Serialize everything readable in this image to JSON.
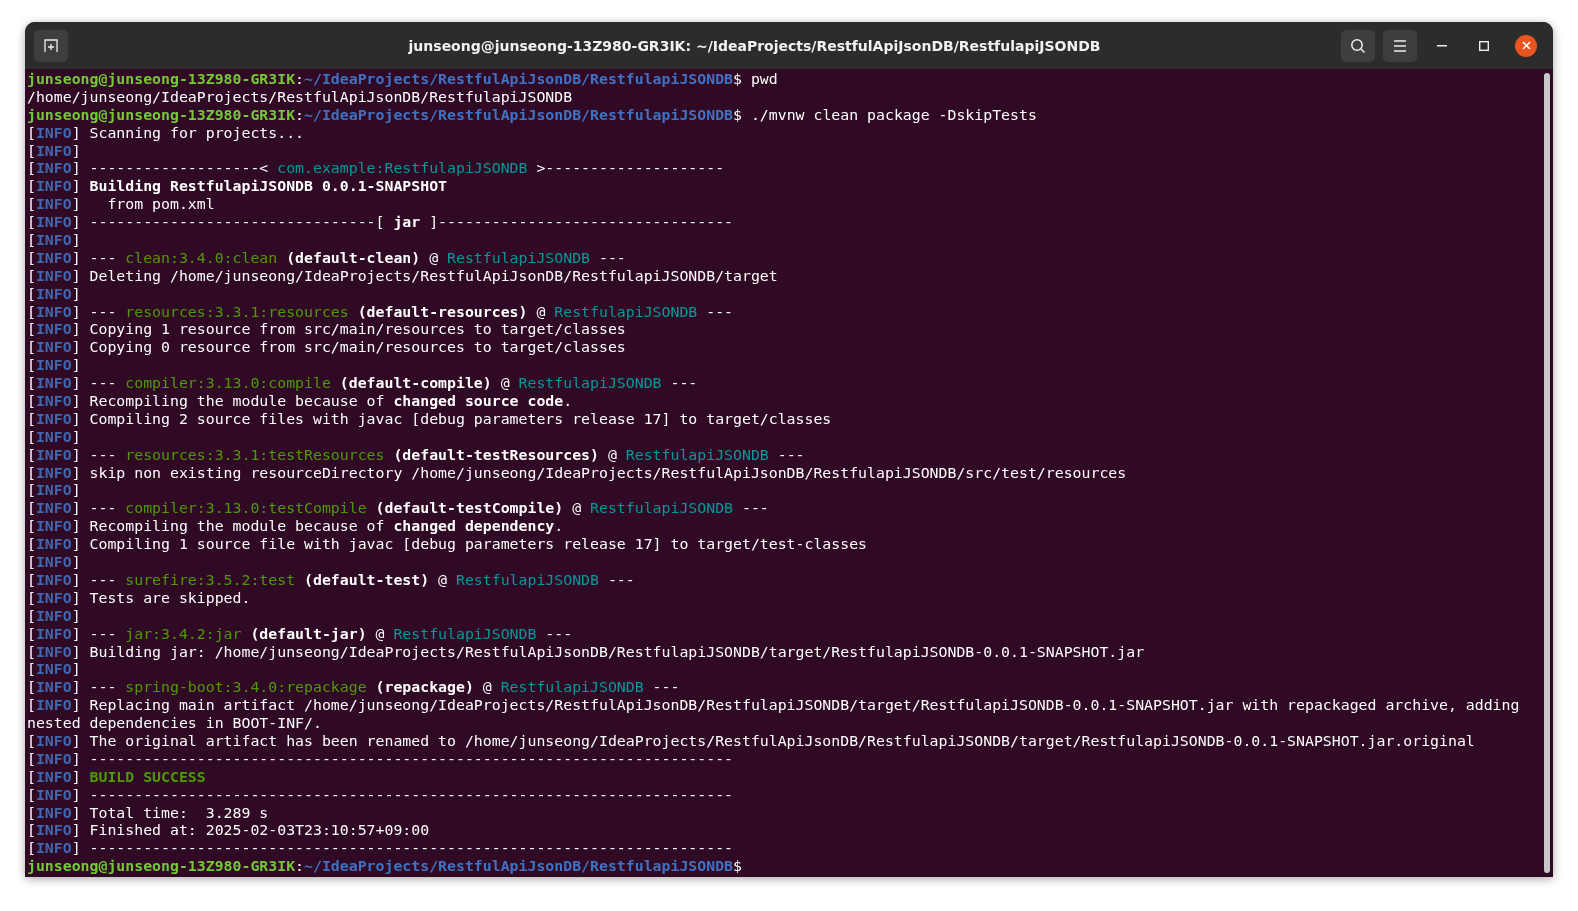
{
  "window": {
    "title": "junseong@junseong-13Z980-GR3IK: ~/IdeaProjects/RestfulApiJsonDB/RestfulapiJSONDB"
  },
  "terminal": {
    "lines": [
      {
        "segments": [
          {
            "kind": "user",
            "text": "junseong@junseong-13Z980-GR3IK"
          },
          {
            "kind": "text",
            "text": ":"
          },
          {
            "kind": "path",
            "text": "~/IdeaProjects/RestfulApiJsonDB/RestfulapiJSONDB"
          },
          {
            "kind": "text",
            "text": "$ pwd"
          }
        ]
      },
      {
        "segments": [
          {
            "kind": "text",
            "text": "/home/junseong/IdeaProjects/RestfulApiJsonDB/RestfulapiJSONDB"
          }
        ]
      },
      {
        "segments": [
          {
            "kind": "user",
            "text": "junseong@junseong-13Z980-GR3IK"
          },
          {
            "kind": "text",
            "text": ":"
          },
          {
            "kind": "path",
            "text": "~/IdeaProjects/RestfulApiJsonDB/RestfulapiJSONDB"
          },
          {
            "kind": "text",
            "text": "$ ./mvnw clean package -DskipTests"
          }
        ]
      },
      {
        "tag": "[INFO]",
        "segments": [
          {
            "kind": "text",
            "text": " Scanning for projects..."
          }
        ]
      },
      {
        "tag": "[INFO]"
      },
      {
        "tag": "[INFO]",
        "segments": [
          {
            "kind": "text",
            "text": " -------------------< "
          },
          {
            "kind": "artifact",
            "text": "com.example:RestfulapiJSONDB"
          },
          {
            "kind": "text",
            "text": " >--------------------"
          }
        ]
      },
      {
        "tag": "[INFO]",
        "segments": [
          {
            "kind": "bold",
            "text": " Building RestfulapiJSONDB 0.0.1-SNAPSHOT"
          }
        ]
      },
      {
        "tag": "[INFO]",
        "segments": [
          {
            "kind": "text",
            "text": "   from pom.xml"
          }
        ]
      },
      {
        "tag": "[INFO]",
        "segments": [
          {
            "kind": "text",
            "text": " --------------------------------[ "
          },
          {
            "kind": "bold",
            "text": "jar"
          },
          {
            "kind": "text",
            "text": " ]---------------------------------"
          }
        ]
      },
      {
        "tag": "[INFO]"
      },
      {
        "tag": "[INFO]",
        "segments": [
          {
            "kind": "text",
            "text": " --- "
          },
          {
            "kind": "plugin",
            "text": "clean:3.4.0:clean"
          },
          {
            "kind": "bold",
            "text": " (default-clean)"
          },
          {
            "kind": "text",
            "text": " @ "
          },
          {
            "kind": "artifact",
            "text": "RestfulapiJSONDB"
          },
          {
            "kind": "text",
            "text": " ---"
          }
        ]
      },
      {
        "tag": "[INFO]",
        "segments": [
          {
            "kind": "text",
            "text": " Deleting /home/junseong/IdeaProjects/RestfulApiJsonDB/RestfulapiJSONDB/target"
          }
        ]
      },
      {
        "tag": "[INFO]"
      },
      {
        "tag": "[INFO]",
        "segments": [
          {
            "kind": "text",
            "text": " --- "
          },
          {
            "kind": "plugin",
            "text": "resources:3.3.1:resources"
          },
          {
            "kind": "bold",
            "text": " (default-resources)"
          },
          {
            "kind": "text",
            "text": " @ "
          },
          {
            "kind": "artifact",
            "text": "RestfulapiJSONDB"
          },
          {
            "kind": "text",
            "text": " ---"
          }
        ]
      },
      {
        "tag": "[INFO]",
        "segments": [
          {
            "kind": "text",
            "text": " Copying 1 resource from src/main/resources to target/classes"
          }
        ]
      },
      {
        "tag": "[INFO]",
        "segments": [
          {
            "kind": "text",
            "text": " Copying 0 resource from src/main/resources to target/classes"
          }
        ]
      },
      {
        "tag": "[INFO]"
      },
      {
        "tag": "[INFO]",
        "segments": [
          {
            "kind": "text",
            "text": " --- "
          },
          {
            "kind": "plugin",
            "text": "compiler:3.13.0:compile"
          },
          {
            "kind": "bold",
            "text": " (default-compile)"
          },
          {
            "kind": "text",
            "text": " @ "
          },
          {
            "kind": "artifact",
            "text": "RestfulapiJSONDB"
          },
          {
            "kind": "text",
            "text": " ---"
          }
        ]
      },
      {
        "tag": "[INFO]",
        "segments": [
          {
            "kind": "text",
            "text": " Recompiling the module because of "
          },
          {
            "kind": "bold",
            "text": "changed source code"
          },
          {
            "kind": "text",
            "text": "."
          }
        ]
      },
      {
        "tag": "[INFO]",
        "segments": [
          {
            "kind": "text",
            "text": " Compiling 2 source files with javac [debug parameters release 17] to target/classes"
          }
        ]
      },
      {
        "tag": "[INFO]"
      },
      {
        "tag": "[INFO]",
        "segments": [
          {
            "kind": "text",
            "text": " --- "
          },
          {
            "kind": "plugin",
            "text": "resources:3.3.1:testResources"
          },
          {
            "kind": "bold",
            "text": " (default-testResources)"
          },
          {
            "kind": "text",
            "text": " @ "
          },
          {
            "kind": "artifact",
            "text": "RestfulapiJSONDB"
          },
          {
            "kind": "text",
            "text": " ---"
          }
        ]
      },
      {
        "tag": "[INFO]",
        "segments": [
          {
            "kind": "text",
            "text": " skip non existing resourceDirectory /home/junseong/IdeaProjects/RestfulApiJsonDB/RestfulapiJSONDB/src/test/resources"
          }
        ]
      },
      {
        "tag": "[INFO]"
      },
      {
        "tag": "[INFO]",
        "segments": [
          {
            "kind": "text",
            "text": " --- "
          },
          {
            "kind": "plugin",
            "text": "compiler:3.13.0:testCompile"
          },
          {
            "kind": "bold",
            "text": " (default-testCompile)"
          },
          {
            "kind": "text",
            "text": " @ "
          },
          {
            "kind": "artifact",
            "text": "RestfulapiJSONDB"
          },
          {
            "kind": "text",
            "text": " ---"
          }
        ]
      },
      {
        "tag": "[INFO]",
        "segments": [
          {
            "kind": "text",
            "text": " Recompiling the module because of "
          },
          {
            "kind": "bold",
            "text": "changed dependency"
          },
          {
            "kind": "text",
            "text": "."
          }
        ]
      },
      {
        "tag": "[INFO]",
        "segments": [
          {
            "kind": "text",
            "text": " Compiling 1 source file with javac [debug parameters release 17] to target/test-classes"
          }
        ]
      },
      {
        "tag": "[INFO]"
      },
      {
        "tag": "[INFO]",
        "segments": [
          {
            "kind": "text",
            "text": " --- "
          },
          {
            "kind": "plugin",
            "text": "surefire:3.5.2:test"
          },
          {
            "kind": "bold",
            "text": " (default-test)"
          },
          {
            "kind": "text",
            "text": " @ "
          },
          {
            "kind": "artifact",
            "text": "RestfulapiJSONDB"
          },
          {
            "kind": "text",
            "text": " ---"
          }
        ]
      },
      {
        "tag": "[INFO]",
        "segments": [
          {
            "kind": "text",
            "text": " Tests are skipped."
          }
        ]
      },
      {
        "tag": "[INFO]"
      },
      {
        "tag": "[INFO]",
        "segments": [
          {
            "kind": "text",
            "text": " --- "
          },
          {
            "kind": "plugin",
            "text": "jar:3.4.2:jar"
          },
          {
            "kind": "bold",
            "text": " (default-jar)"
          },
          {
            "kind": "text",
            "text": " @ "
          },
          {
            "kind": "artifact",
            "text": "RestfulapiJSONDB"
          },
          {
            "kind": "text",
            "text": " ---"
          }
        ]
      },
      {
        "tag": "[INFO]",
        "segments": [
          {
            "kind": "text",
            "text": " Building jar: /home/junseong/IdeaProjects/RestfulApiJsonDB/RestfulapiJSONDB/target/RestfulapiJSONDB-0.0.1-SNAPSHOT.jar"
          }
        ]
      },
      {
        "tag": "[INFO]"
      },
      {
        "tag": "[INFO]",
        "segments": [
          {
            "kind": "text",
            "text": " --- "
          },
          {
            "kind": "plugin",
            "text": "spring-boot:3.4.0:repackage"
          },
          {
            "kind": "bold",
            "text": " (repackage)"
          },
          {
            "kind": "text",
            "text": " @ "
          },
          {
            "kind": "artifact",
            "text": "RestfulapiJSONDB"
          },
          {
            "kind": "text",
            "text": " ---"
          }
        ]
      },
      {
        "tag": "[INFO]",
        "segments": [
          {
            "kind": "text",
            "text": " Replacing main artifact /home/junseong/IdeaProjects/RestfulApiJsonDB/RestfulapiJSONDB/target/RestfulapiJSONDB-0.0.1-SNAPSHOT.jar with repackaged archive, adding"
          }
        ]
      },
      {
        "segments": [
          {
            "kind": "text",
            "text": "nested dependencies in BOOT-INF/."
          }
        ]
      },
      {
        "tag": "[INFO]",
        "segments": [
          {
            "kind": "text",
            "text": " The original artifact has been renamed to /home/junseong/IdeaProjects/RestfulApiJsonDB/RestfulapiJSONDB/target/RestfulapiJSONDB-0.0.1-SNAPSHOT.jar.original"
          }
        ]
      },
      {
        "tag": "[INFO]",
        "segments": [
          {
            "kind": "text",
            "text": " ------------------------------------------------------------------------"
          }
        ]
      },
      {
        "tag": "[INFO]",
        "segments": [
          {
            "kind": "success",
            "text": " BUILD SUCCESS"
          }
        ]
      },
      {
        "tag": "[INFO]",
        "segments": [
          {
            "kind": "text",
            "text": " ------------------------------------------------------------------------"
          }
        ]
      },
      {
        "tag": "[INFO]",
        "segments": [
          {
            "kind": "text",
            "text": " Total time:  3.289 s"
          }
        ]
      },
      {
        "tag": "[INFO]",
        "segments": [
          {
            "kind": "text",
            "text": " Finished at: 2025-02-03T23:10:57+09:00"
          }
        ]
      },
      {
        "tag": "[INFO]",
        "segments": [
          {
            "kind": "text",
            "text": " ------------------------------------------------------------------------"
          }
        ]
      },
      {
        "segments": [
          {
            "kind": "user",
            "text": "junseong@junseong-13Z980-GR3IK"
          },
          {
            "kind": "text",
            "text": ":"
          },
          {
            "kind": "path",
            "text": "~/IdeaProjects/RestfulApiJsonDB/RestfulapiJSONDB"
          },
          {
            "kind": "text",
            "text": "$"
          }
        ]
      }
    ]
  }
}
